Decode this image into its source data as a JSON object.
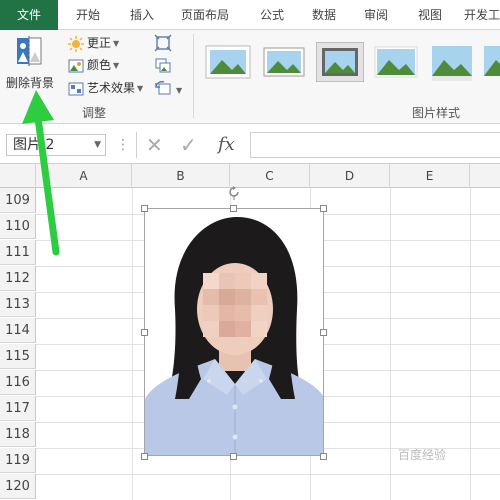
{
  "ribbon_tabs": [
    "文件",
    "开始",
    "插入",
    "页面布局",
    "公式",
    "数据",
    "审阅",
    "视图",
    "开发工"
  ],
  "adjust_group": {
    "remove_background": "删除背景",
    "corrections": "更正",
    "color": "颜色",
    "artistic_effects": "艺术效果",
    "label": "调整"
  },
  "styles_group": {
    "label": "图片样式"
  },
  "formula_bar": {
    "name_box": "图片 2",
    "cancel_icon": "✕",
    "enter_icon": "✓",
    "fx": "fx",
    "formula_value": ""
  },
  "columns": [
    "A",
    "B",
    "C",
    "D",
    "E"
  ],
  "rows": [
    "109",
    "110",
    "111",
    "112",
    "113",
    "114",
    "115",
    "116",
    "117",
    "118",
    "119",
    "120"
  ],
  "selected_object": "portrait-photo",
  "watermark": "百度经验",
  "colors": {
    "file_tab": "#217346",
    "arrow": "#2ecc40",
    "shirt": "#b8c8e6",
    "hair": "#1c1a1a"
  }
}
